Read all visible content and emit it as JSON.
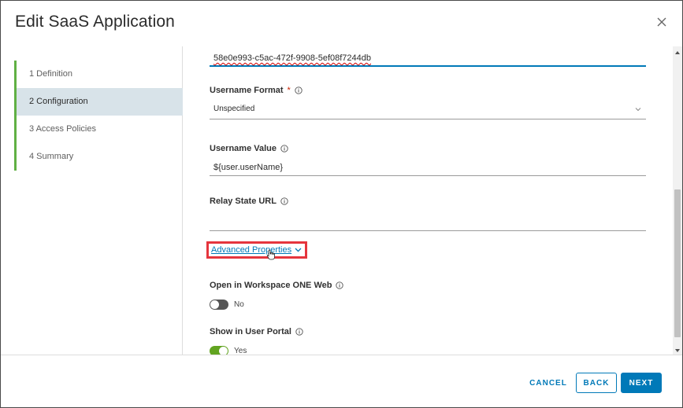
{
  "dialog": {
    "title": "Edit SaaS Application"
  },
  "steps": [
    {
      "label": "1  Definition",
      "active": false
    },
    {
      "label": "2  Configuration",
      "active": true
    },
    {
      "label": "3  Access Policies",
      "active": false
    },
    {
      "label": "4  Summary",
      "active": false
    }
  ],
  "form": {
    "id_field": {
      "value": "58e0e993-c5ac-472f-9908-5ef08f7244db"
    },
    "username_format": {
      "label": "Username Format",
      "required_marker": "*",
      "selected": "Unspecified"
    },
    "username_value": {
      "label": "Username Value",
      "value": "${user.userName}"
    },
    "relay_state_url": {
      "label": "Relay State URL",
      "value": ""
    },
    "advanced_properties": {
      "label": "Advanced Properties"
    },
    "open_in_workspace": {
      "label": "Open in Workspace ONE Web",
      "state": "No",
      "on": false
    },
    "show_in_user_portal": {
      "label": "Show in User Portal",
      "state": "Yes",
      "on": true
    }
  },
  "footer": {
    "cancel_label": "CANCEL",
    "back_label": "BACK",
    "next_label": "NEXT"
  },
  "colors": {
    "accent": "#0079b8",
    "step_bar": "#60b044",
    "highlight_box": "#e5353d",
    "toggle_on": "#62a420",
    "toggle_off": "#565656"
  },
  "icons": {
    "close": "close-icon",
    "info": "info-icon",
    "chevron": "chevron-down-icon",
    "cursor": "hand-cursor-icon"
  }
}
